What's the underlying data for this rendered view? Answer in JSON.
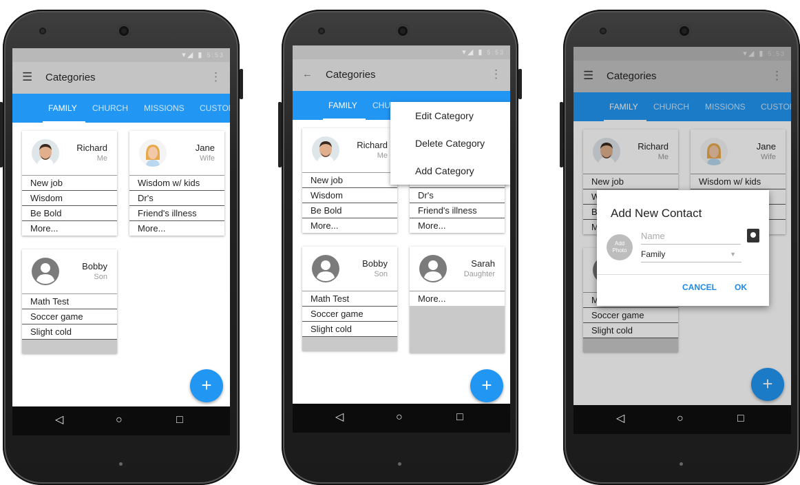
{
  "statusbar": {
    "signal_icon": "▾◢",
    "battery_icon": "▮",
    "clock": "5:53"
  },
  "appbar": {
    "title": "Categories",
    "menu_icon": "⋮",
    "hamburger_icon": "☰",
    "back_icon": "←"
  },
  "tabs": [
    "FAMILY",
    "CHURCH",
    "MISSIONS",
    "CUSTOM"
  ],
  "contacts": {
    "richard": {
      "name": "Richard",
      "role": "Me",
      "items": [
        "New job",
        "Wisdom",
        "Be Bold",
        "More..."
      ]
    },
    "jane": {
      "name": "Jane",
      "role": "Wife",
      "items": [
        "Wisdom w/ kids",
        "Dr's",
        "Friend's illness",
        "More..."
      ]
    },
    "bobby": {
      "name": "Bobby",
      "role": "Son",
      "items": [
        "Math Test",
        "Soccer game",
        "Slight cold"
      ]
    },
    "sarah": {
      "name": "Sarah",
      "role": "Daughter",
      "items": [
        "More..."
      ]
    }
  },
  "fab": {
    "label": "+"
  },
  "navbar": {
    "back": "◁",
    "home": "○",
    "recents": "□"
  },
  "menu": {
    "items": [
      "Edit Category",
      "Delete Category",
      "Add Category"
    ]
  },
  "dialog": {
    "title": "Add New Contact",
    "photo_line1": "Add",
    "photo_line2": "Photo",
    "name_placeholder": "Name",
    "group_value": "Family",
    "group_caret": "▼",
    "cancel": "CANCEL",
    "ok": "OK"
  },
  "colors": {
    "accent": "#2196F3",
    "appbar": "#c4c4c4",
    "statusbar": "#b8b8b8"
  }
}
